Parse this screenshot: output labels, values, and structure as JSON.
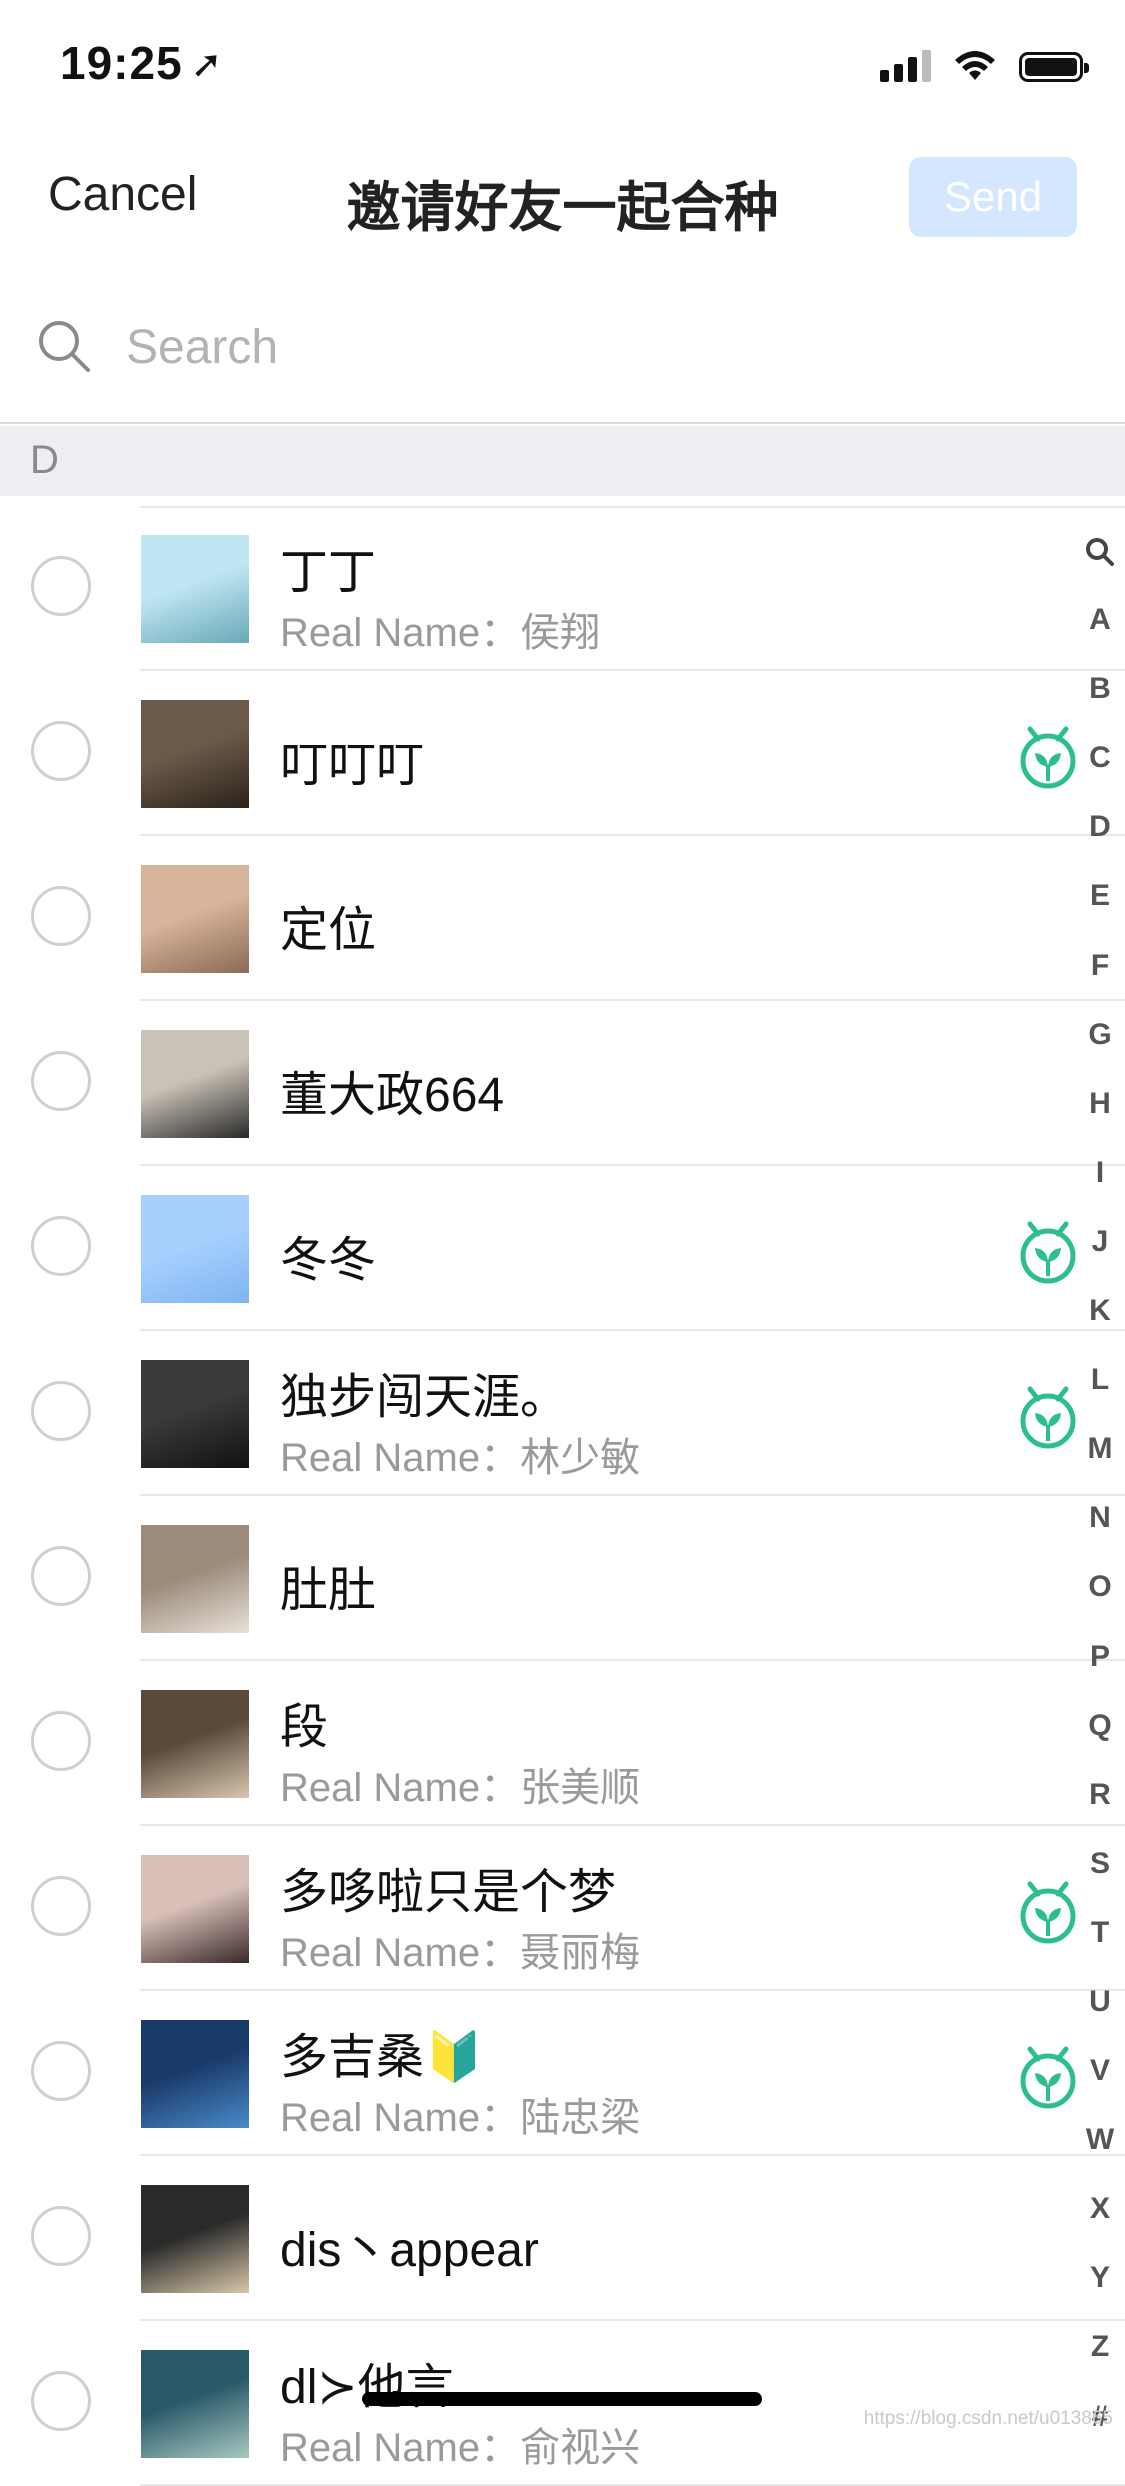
{
  "status_bar": {
    "time": "19:25",
    "location_icon": "location-arrow-icon"
  },
  "nav": {
    "cancel_label": "Cancel",
    "title": "邀请好友一起合种",
    "send_label": "Send"
  },
  "search": {
    "placeholder": "Search",
    "value": ""
  },
  "section": {
    "label": "D"
  },
  "contacts": [
    {
      "name": "丁丁",
      "real_name": "Real Name：侯翔",
      "badge": false,
      "avatar_colors": [
        "#bfe6f2",
        "#6aa8b8"
      ]
    },
    {
      "name": "叮叮叮",
      "real_name": "",
      "badge": true,
      "avatar_colors": [
        "#6b5a4a",
        "#2c221a"
      ]
    },
    {
      "name": "定位",
      "real_name": "",
      "badge": false,
      "avatar_colors": [
        "#d8b49a",
        "#8a6b55"
      ]
    },
    {
      "name": "董大政664",
      "real_name": "",
      "badge": false,
      "avatar_colors": [
        "#c9c2b6",
        "#2a2a2a"
      ]
    },
    {
      "name": "冬冬",
      "real_name": "",
      "badge": true,
      "avatar_colors": [
        "#a8d0ff",
        "#7fb4f0"
      ]
    },
    {
      "name": "独步闯天涯。",
      "real_name": "Real Name：林少敏",
      "badge": true,
      "avatar_colors": [
        "#3a3a3a",
        "#111111"
      ]
    },
    {
      "name": "肚肚",
      "real_name": "",
      "badge": false,
      "avatar_colors": [
        "#9a8b7a",
        "#e8e0d8"
      ]
    },
    {
      "name": "段",
      "real_name": "Real Name：张美顺",
      "badge": false,
      "avatar_colors": [
        "#5a4a3a",
        "#d8c8b0"
      ]
    },
    {
      "name": "多哆啦只是个梦",
      "real_name": "Real Name：聂丽梅",
      "badge": true,
      "avatar_colors": [
        "#d8c0b8",
        "#3a2a2a"
      ]
    },
    {
      "name": "多吉桑🔰",
      "real_name": "Real Name：陆忠梁",
      "badge": true,
      "avatar_colors": [
        "#1a3a6a",
        "#4a8ac8"
      ]
    },
    {
      "name": "dis丶appear",
      "real_name": "",
      "badge": false,
      "avatar_colors": [
        "#2a2a2a",
        "#d8c8a8"
      ]
    },
    {
      "name": "dl≻他言",
      "real_name": "Real Name：俞视兴",
      "badge": false,
      "avatar_colors": [
        "#2a5a6a",
        "#a8c8c0"
      ]
    }
  ],
  "index_letters": [
    "Q-icon",
    "A",
    "B",
    "C",
    "D",
    "E",
    "F",
    "G",
    "H",
    "I",
    "J",
    "K",
    "L",
    "M",
    "N",
    "O",
    "P",
    "Q",
    "R",
    "S",
    "T",
    "U",
    "V",
    "W",
    "X",
    "Y",
    "Z",
    "#"
  ],
  "colors": {
    "accent": "#2dbe8e",
    "send_disabled_bg": "#d5e7ff",
    "section_bg": "#eeeef2"
  },
  "watermark": "https://blog.csdn.net/u013865"
}
